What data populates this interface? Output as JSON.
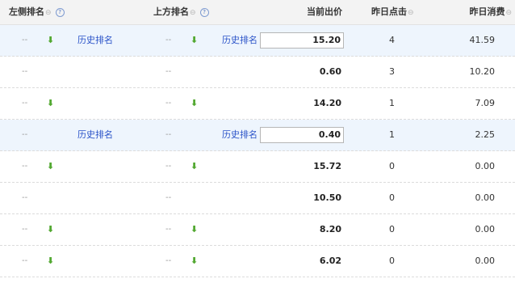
{
  "header": {
    "left_rank": "左侧排名",
    "top_rank": "上方排名",
    "current_bid": "当前出价",
    "yesterday_clicks": "昨日点击",
    "yesterday_cost": "昨日消费",
    "sort_glyph": "⊖",
    "help_glyph": "?"
  },
  "placeholder": "--",
  "arrow_glyph": "⬇",
  "history_label": "历史排名",
  "rows": [
    {
      "left_arrow": true,
      "left_history": true,
      "top_arrow": true,
      "top_history": true,
      "bid": "15.20",
      "bid_box": true,
      "clicks": "4",
      "cost": "41.59",
      "highlighted": true
    },
    {
      "left_arrow": false,
      "left_history": false,
      "top_arrow": false,
      "top_history": false,
      "bid": "0.60",
      "bid_box": false,
      "clicks": "3",
      "cost": "10.20",
      "highlighted": false
    },
    {
      "left_arrow": true,
      "left_history": false,
      "top_arrow": true,
      "top_history": false,
      "bid": "14.20",
      "bid_box": false,
      "clicks": "1",
      "cost": "7.09",
      "highlighted": false
    },
    {
      "left_arrow": false,
      "left_history": true,
      "top_arrow": false,
      "top_history": true,
      "bid": "0.40",
      "bid_box": true,
      "clicks": "1",
      "cost": "2.25",
      "highlighted": true
    },
    {
      "left_arrow": true,
      "left_history": false,
      "top_arrow": true,
      "top_history": false,
      "bid": "15.72",
      "bid_box": false,
      "clicks": "0",
      "cost": "0.00",
      "highlighted": false
    },
    {
      "left_arrow": false,
      "left_history": false,
      "top_arrow": false,
      "top_history": false,
      "bid": "10.50",
      "bid_box": false,
      "clicks": "0",
      "cost": "0.00",
      "highlighted": false
    },
    {
      "left_arrow": true,
      "left_history": false,
      "top_arrow": true,
      "top_history": false,
      "bid": "8.20",
      "bid_box": false,
      "clicks": "0",
      "cost": "0.00",
      "highlighted": false
    },
    {
      "left_arrow": true,
      "left_history": false,
      "top_arrow": true,
      "top_history": false,
      "bid": "6.02",
      "bid_box": false,
      "clicks": "0",
      "cost": "0.00",
      "highlighted": false
    }
  ],
  "colors": {
    "highlight_row": "#eef5fd",
    "arrow": "#52a831",
    "link": "#2952c8"
  }
}
